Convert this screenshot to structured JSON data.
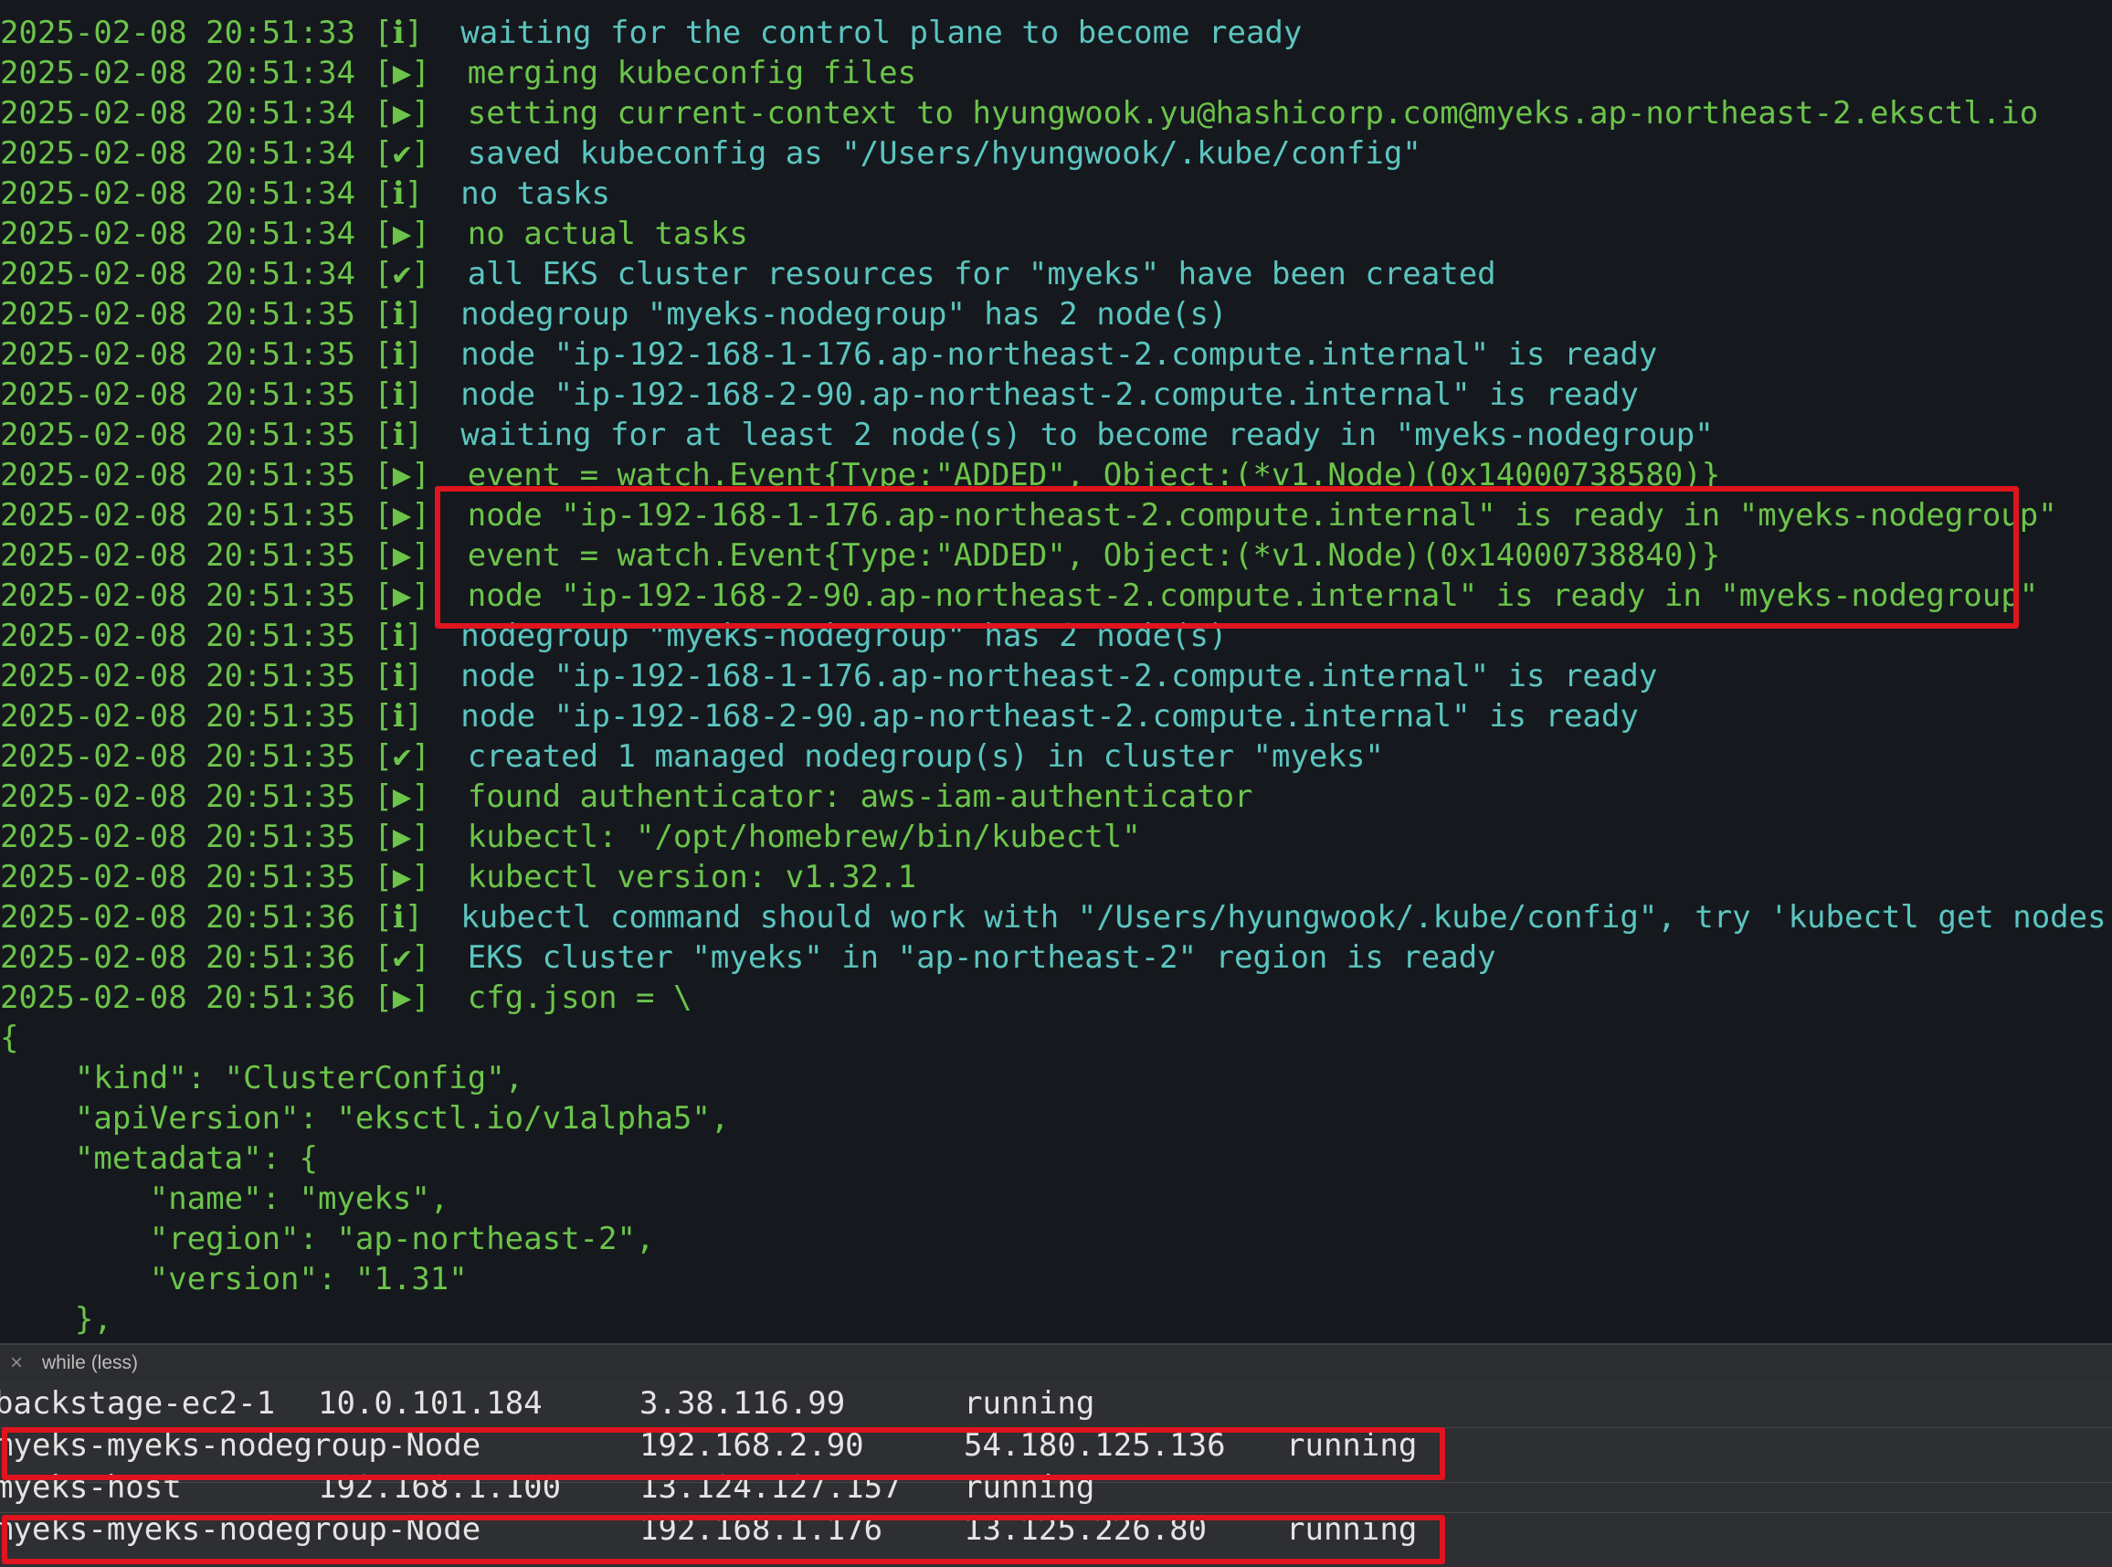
{
  "terminal": {
    "log_lines": [
      {
        "ts": "2025-02-08 20:51:33",
        "level": "[ℹ]",
        "msg": "waiting for the control plane to become ready",
        "tone": "teal"
      },
      {
        "ts": "2025-02-08 20:51:34",
        "level": "[▶]",
        "msg": "merging kubeconfig files",
        "tone": "green"
      },
      {
        "ts": "2025-02-08 20:51:34",
        "level": "[▶]",
        "msg": "setting current-context to hyungwook.yu@hashicorp.com@myeks.ap-northeast-2.eksctl.io",
        "tone": "green"
      },
      {
        "ts": "2025-02-08 20:51:34",
        "level": "[✔]",
        "msg": "saved kubeconfig as \"/Users/hyungwook/.kube/config\"",
        "tone": "teal"
      },
      {
        "ts": "2025-02-08 20:51:34",
        "level": "[ℹ]",
        "msg": "no tasks",
        "tone": "teal"
      },
      {
        "ts": "2025-02-08 20:51:34",
        "level": "[▶]",
        "msg": "no actual tasks",
        "tone": "green"
      },
      {
        "ts": "2025-02-08 20:51:34",
        "level": "[✔]",
        "msg": "all EKS cluster resources for \"myeks\" have been created",
        "tone": "teal"
      },
      {
        "ts": "2025-02-08 20:51:35",
        "level": "[ℹ]",
        "msg": "nodegroup \"myeks-nodegroup\" has 2 node(s)",
        "tone": "teal"
      },
      {
        "ts": "2025-02-08 20:51:35",
        "level": "[ℹ]",
        "msg": "node \"ip-192-168-1-176.ap-northeast-2.compute.internal\" is ready",
        "tone": "teal"
      },
      {
        "ts": "2025-02-08 20:51:35",
        "level": "[ℹ]",
        "msg": "node \"ip-192-168-2-90.ap-northeast-2.compute.internal\" is ready",
        "tone": "teal"
      },
      {
        "ts": "2025-02-08 20:51:35",
        "level": "[ℹ]",
        "msg": "waiting for at least 2 node(s) to become ready in \"myeks-nodegroup\"",
        "tone": "teal"
      },
      {
        "ts": "2025-02-08 20:51:35",
        "level": "[▶]",
        "msg": "event = watch.Event{Type:\"ADDED\", Object:(*v1.Node)(0x14000738580)}",
        "tone": "green"
      },
      {
        "ts": "2025-02-08 20:51:35",
        "level": "[▶]",
        "msg": "node \"ip-192-168-1-176.ap-northeast-2.compute.internal\" is ready in \"myeks-nodegroup\"",
        "tone": "green"
      },
      {
        "ts": "2025-02-08 20:51:35",
        "level": "[▶]",
        "msg": "event = watch.Event{Type:\"ADDED\", Object:(*v1.Node)(0x14000738840)}",
        "tone": "green"
      },
      {
        "ts": "2025-02-08 20:51:35",
        "level": "[▶]",
        "msg": "node \"ip-192-168-2-90.ap-northeast-2.compute.internal\" is ready in \"myeks-nodegroup\"",
        "tone": "green"
      },
      {
        "ts": "2025-02-08 20:51:35",
        "level": "[ℹ]",
        "msg": "nodegroup \"myeks-nodegroup\" has 2 node(s)",
        "tone": "teal"
      },
      {
        "ts": "2025-02-08 20:51:35",
        "level": "[ℹ]",
        "msg": "node \"ip-192-168-1-176.ap-northeast-2.compute.internal\" is ready",
        "tone": "teal"
      },
      {
        "ts": "2025-02-08 20:51:35",
        "level": "[ℹ]",
        "msg": "node \"ip-192-168-2-90.ap-northeast-2.compute.internal\" is ready",
        "tone": "teal"
      },
      {
        "ts": "2025-02-08 20:51:35",
        "level": "[✔]",
        "msg": "created 1 managed nodegroup(s) in cluster \"myeks\"",
        "tone": "teal"
      },
      {
        "ts": "2025-02-08 20:51:35",
        "level": "[▶]",
        "msg": "found authenticator: aws-iam-authenticator",
        "tone": "green"
      },
      {
        "ts": "2025-02-08 20:51:35",
        "level": "[▶]",
        "msg": "kubectl: \"/opt/homebrew/bin/kubectl\"",
        "tone": "green"
      },
      {
        "ts": "2025-02-08 20:51:35",
        "level": "[▶]",
        "msg": "kubectl version: v1.32.1",
        "tone": "green"
      },
      {
        "ts": "2025-02-08 20:51:36",
        "level": "[ℹ]",
        "msg": "kubectl command should work with \"/Users/hyungwook/.kube/config\", try 'kubectl get nodes'",
        "tone": "teal"
      },
      {
        "ts": "2025-02-08 20:51:36",
        "level": "[✔]",
        "msg": "EKS cluster \"myeks\" in \"ap-northeast-2\" region is ready",
        "tone": "teal"
      },
      {
        "ts": "2025-02-08 20:51:36",
        "level": "[▶]",
        "msg": "cfg.json = \\",
        "tone": "green"
      }
    ],
    "json_lines": [
      "{",
      "    \"kind\": \"ClusterConfig\",",
      "    \"apiVersion\": \"eksctl.io/v1alpha5\",",
      "    \"metadata\": {",
      "        \"name\": \"myeks\",",
      "        \"region\": \"ap-northeast-2\",",
      "        \"version\": \"1.31\"",
      "    },"
    ]
  },
  "pane": {
    "close_glyph": "×",
    "title": "while (less)"
  },
  "instances": {
    "rows": [
      {
        "name": "backstage-ec2-1",
        "private_ip": "10.0.101.184",
        "public_ip": "3.38.116.99",
        "state": "running",
        "highlighted": false
      },
      {
        "name": "myeks-myeks-nodegroup-Node",
        "private_ip": "192.168.2.90",
        "public_ip": "54.180.125.136",
        "state": "running",
        "highlighted": true
      },
      {
        "name": "myeks-host",
        "private_ip": "192.168.1.100",
        "public_ip": "13.124.127.157",
        "state": "running",
        "highlighted": false
      },
      {
        "name": "myeks-myeks-nodegroup-Node",
        "private_ip": "192.168.1.176",
        "public_ip": "13.125.226.80",
        "state": "running",
        "highlighted": true
      }
    ]
  },
  "colors": {
    "terminal_bg": "#15191e",
    "timestamp_green": "#6cc44a",
    "message_teal": "#5cc5c0",
    "pane_bg": "#2d2f32",
    "highlight_red": "#e0141e"
  },
  "icons": {
    "pane_close": "close-icon"
  }
}
